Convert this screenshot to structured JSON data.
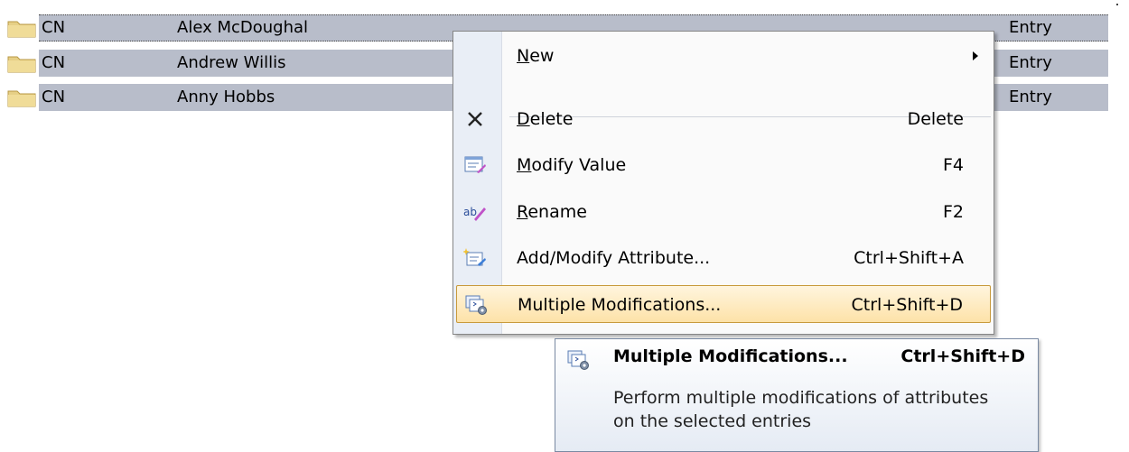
{
  "entries": [
    {
      "type": "CN",
      "name": "Alex McDoughal",
      "kind": "Entry",
      "icon": "folder-icon"
    },
    {
      "type": "CN",
      "name": "Andrew Willis",
      "kind": "Entry",
      "icon": "folder-icon"
    },
    {
      "type": "CN",
      "name": "Anny Hobbs",
      "kind": "Entry",
      "icon": "folder-icon"
    }
  ],
  "context_menu": {
    "new": {
      "mnemonic": "N",
      "rest": "ew",
      "icon": "submenu-arrow-icon"
    },
    "delete": {
      "mnemonic": "D",
      "rest": "elete",
      "shortcut": "Delete",
      "icon": "delete-x-icon"
    },
    "modify_value": {
      "mnemonic": "M",
      "rest": "odify Value",
      "shortcut": "F4",
      "icon": "modify-value-icon"
    },
    "rename": {
      "mnemonic": "R",
      "rest": "ename",
      "shortcut": "F2",
      "icon": "rename-icon"
    },
    "add_modify_attribute": {
      "label": "Add/Modify Attribute...",
      "shortcut": "Ctrl+Shift+A",
      "icon": "add-attribute-icon"
    },
    "multiple_modifications": {
      "label": "Multiple Modifications...",
      "shortcut": "Ctrl+Shift+D",
      "icon": "multiple-modifications-icon",
      "highlighted": true
    }
  },
  "tooltip": {
    "title": "Multiple Modifications...",
    "shortcut": "Ctrl+Shift+D",
    "description": "Perform multiple modifications of attributes on the selected entries"
  },
  "colors": {
    "selection_band": "#b8bdca",
    "menu_gutter": "#e9eef6",
    "highlight": "#fde2a8"
  }
}
